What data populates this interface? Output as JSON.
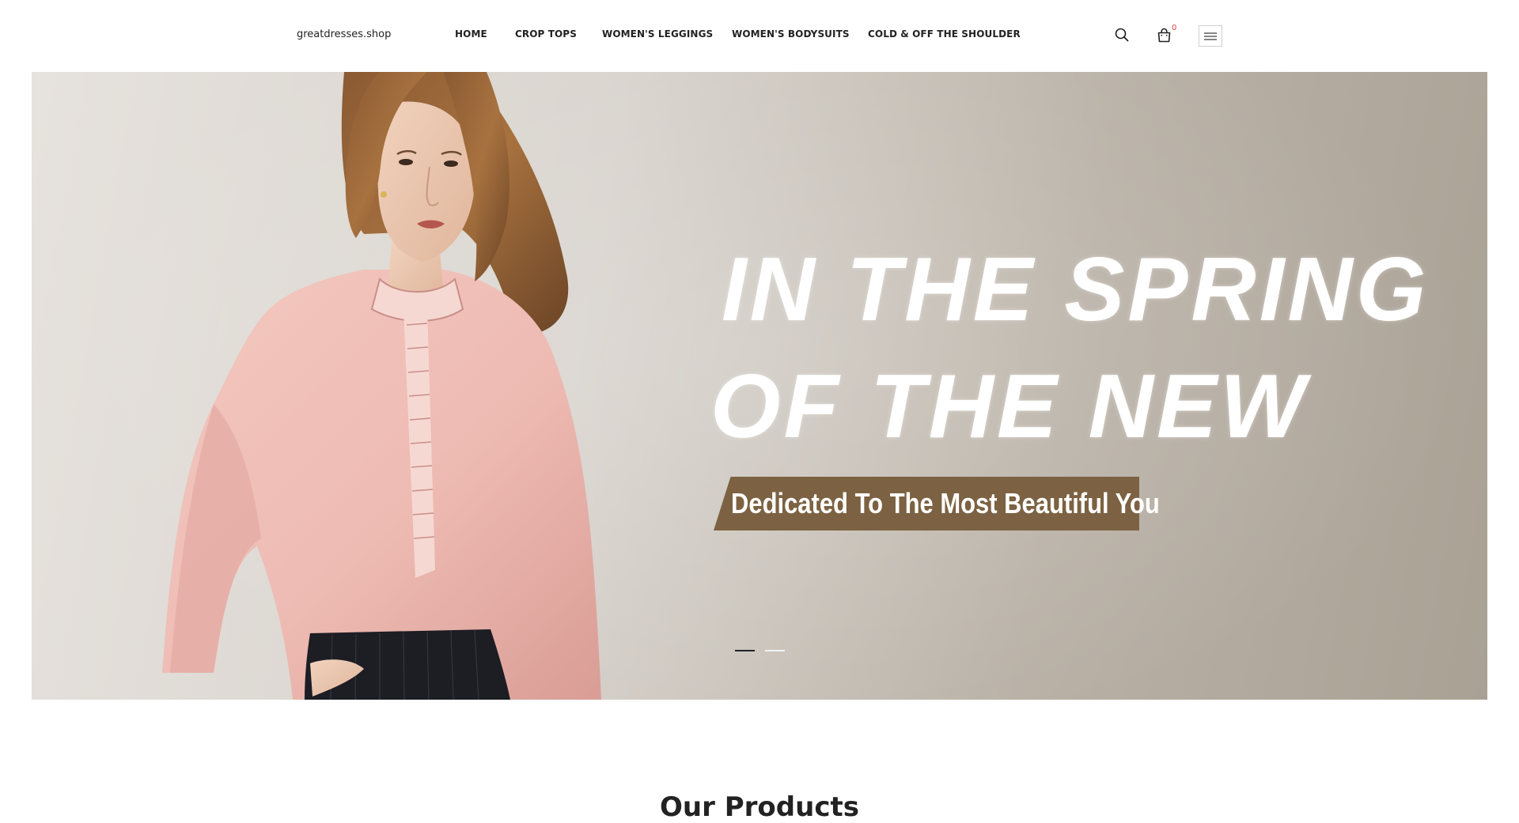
{
  "header": {
    "logo": "greatdresses.shop",
    "nav": {
      "home": "HOME",
      "crop_tops": "CROP TOPS",
      "leggings": "WOMEN'S LEGGINGS",
      "bodysuits": "WOMEN'S BODYSUITS",
      "cold_shoulder": "COLD & OFF THE SHOULDER"
    },
    "cart_count": "0",
    "icons": {
      "search": "search-icon",
      "cart": "shopping-bag-icon",
      "menu": "hamburger-menu-icon"
    }
  },
  "hero": {
    "line1": "IN THE SPRING",
    "line2": "OF THE NEW",
    "tagline": "Dedicated To The Most Beautiful You",
    "slides_total": 2,
    "active_slide": 1,
    "colors": {
      "tagline_bg": "#7c6242",
      "blouse": "#eebbb3"
    }
  },
  "products": {
    "title": "Our Products"
  },
  "colors": {
    "cart_badge": "#d64545",
    "text": "#222222"
  }
}
